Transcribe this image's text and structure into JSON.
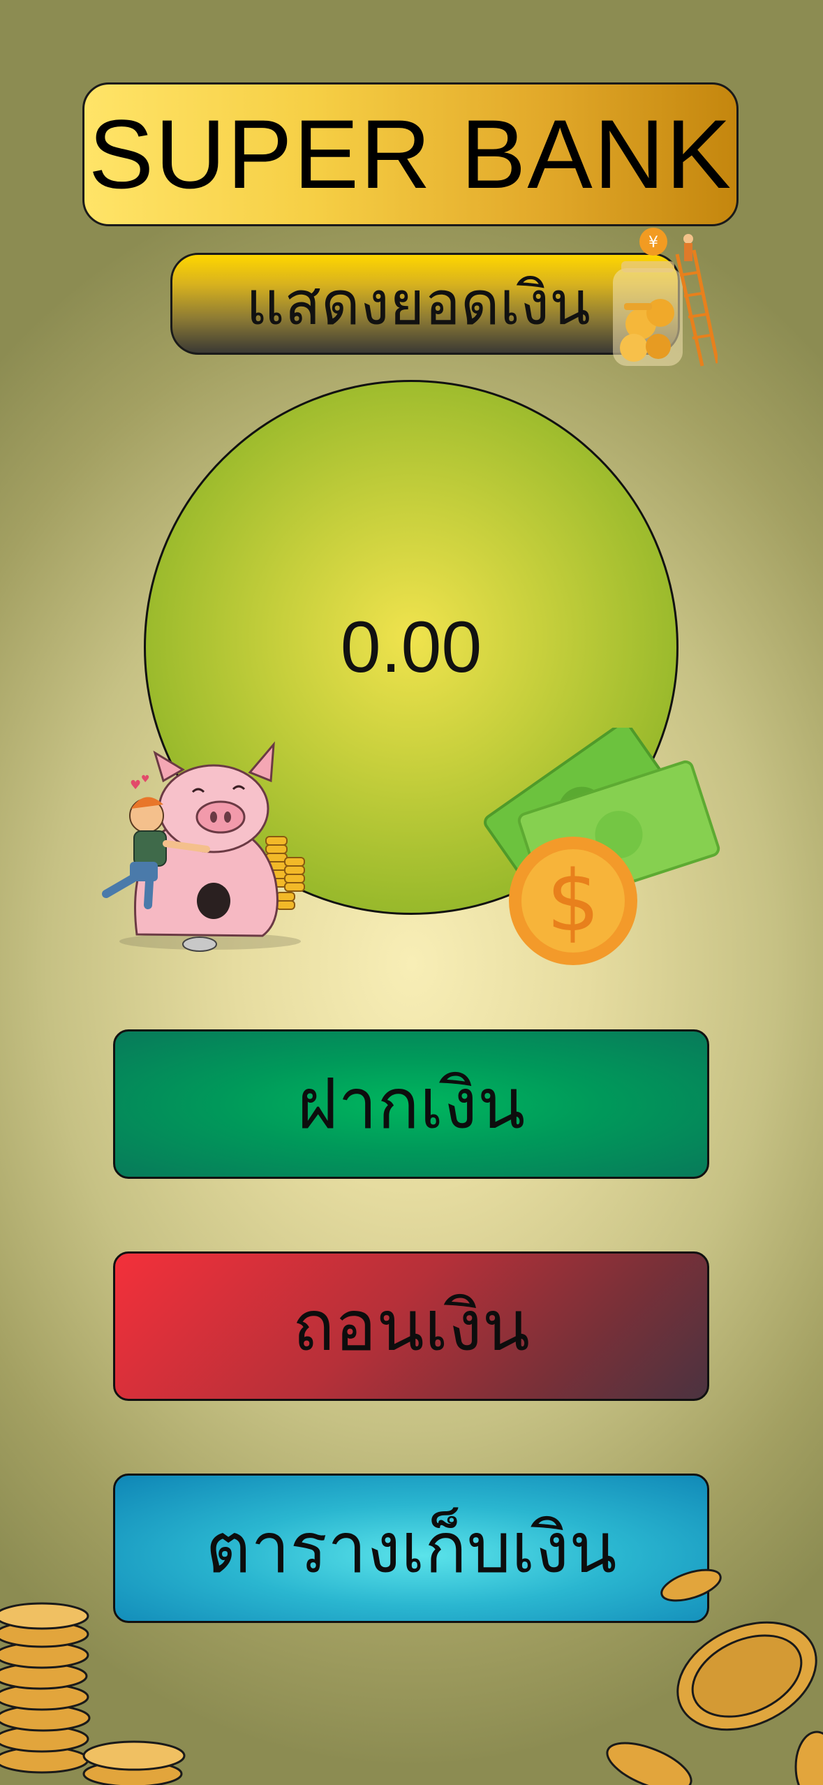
{
  "app": {
    "title": "SUPER BANK"
  },
  "balance": {
    "label": "แสดงยอดเงิน",
    "value": "0.00"
  },
  "actions": {
    "deposit_label": "ฝากเงิน",
    "withdraw_label": "ถอนเงิน",
    "savings_table_label": "ตารางเก็บเงิน"
  },
  "icons": {
    "jar": "coin-jar-icon",
    "pig": "piggy-bank-icon",
    "money": "money-icon",
    "coins": "coins-icon"
  },
  "colors": {
    "title_gold": "#f2c643",
    "circle_green": "#9aba2c",
    "deposit_green": "#00a05c",
    "withdraw_red": "#c8303a",
    "savings_blue": "#2ab6d0",
    "dollar_orange": "#f5a623"
  }
}
